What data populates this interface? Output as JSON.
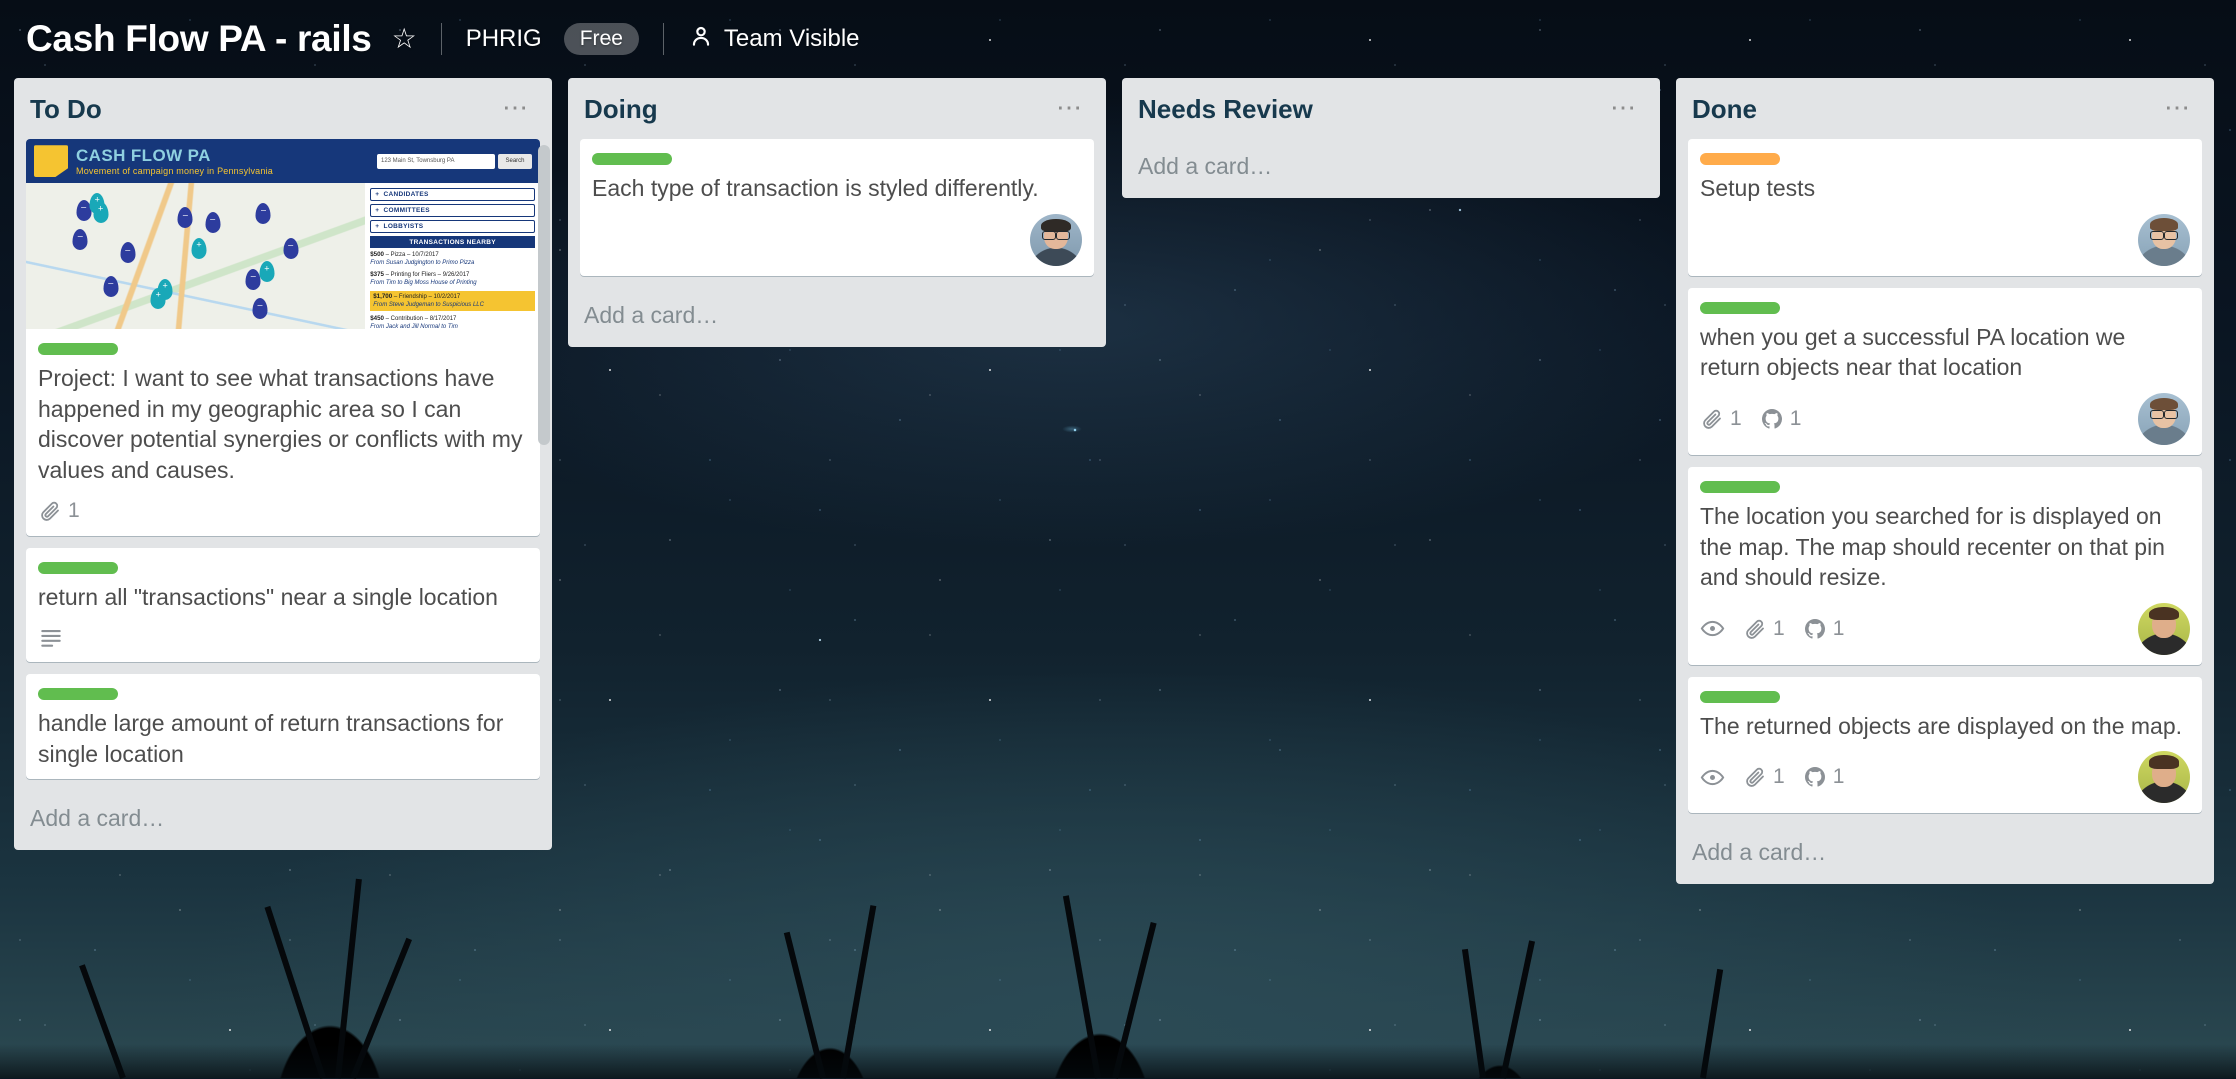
{
  "header": {
    "board_title": "Cash Flow PA - rails",
    "star_icon": "star-icon",
    "team_name": "PHRIG",
    "plan_badge": "Free",
    "visibility_icon": "person-icon",
    "visibility_label": "Team Visible"
  },
  "colors": {
    "label_green": "#61bd4f",
    "label_orange": "#ffab4a",
    "list_bg": "#e2e4e6",
    "card_bg": "#ffffff",
    "title_color": "#17394d",
    "body_text": "#4d4d4d",
    "muted_text": "#838c91"
  },
  "add_card_label": "Add a card…",
  "list_menu_icon": "ellipsis-icon",
  "lists": [
    {
      "title": "To Do",
      "cards": [
        {
          "label_color": "#61bd4f",
          "title": "Project: I want to see what transactions have happened in my geographic area so I can discover potential synergies or conflicts with my values and causes.",
          "cover": true,
          "badges": [
            {
              "icon": "paperclip-icon",
              "count": "1"
            }
          ],
          "avatar": null
        },
        {
          "label_color": "#61bd4f",
          "title": "return all \"transactions\" near a single location",
          "cover": false,
          "badges": [
            {
              "icon": "description-icon",
              "count": ""
            }
          ],
          "avatar": null
        },
        {
          "label_color": "#61bd4f",
          "title": "handle large amount of return transactions for single location",
          "cover": false,
          "badges": [],
          "avatar": null
        }
      ]
    },
    {
      "title": "Doing",
      "cards": [
        {
          "label_color": "#61bd4f",
          "title": "Each type of transaction is styled differently.",
          "cover": false,
          "badges": [],
          "avatar": "f1"
        }
      ]
    },
    {
      "title": "Needs Review",
      "cards": []
    },
    {
      "title": "Done",
      "cards": [
        {
          "label_color": "#ffab4a",
          "title": "Setup tests",
          "cover": false,
          "badges": [],
          "avatar": "f2"
        },
        {
          "label_color": "#61bd4f",
          "title": "when you get a successful PA location we return objects near that location",
          "cover": false,
          "badges": [
            {
              "icon": "paperclip-icon",
              "count": "1"
            },
            {
              "icon": "github-icon",
              "count": "1"
            }
          ],
          "avatar": "f2"
        },
        {
          "label_color": "#61bd4f",
          "title": "The location you searched for is displayed on the map. The map should recenter on that pin and should resize.",
          "cover": false,
          "badges": [
            {
              "icon": "eye-icon",
              "count": ""
            },
            {
              "icon": "paperclip-icon",
              "count": "1"
            },
            {
              "icon": "github-icon",
              "count": "1"
            }
          ],
          "avatar": "f3"
        },
        {
          "label_color": "#61bd4f",
          "title": "The returned objects are displayed on the map.",
          "cover": false,
          "badges": [
            {
              "icon": "eye-icon",
              "count": ""
            },
            {
              "icon": "paperclip-icon",
              "count": "1"
            },
            {
              "icon": "github-icon",
              "count": "1"
            }
          ],
          "avatar": "f3"
        }
      ]
    }
  ],
  "cover_image": {
    "brand": "CASH FLOW PA",
    "tagline": "Movement of campaign money in Pennsylvania",
    "search_value": "123 Main St, Townsburg PA",
    "search_button": "Search",
    "accordions": [
      "CANDIDATES",
      "COMMITTEES",
      "LOBBYISTS"
    ],
    "transactions_header": "TRANSACTIONS NEARBY",
    "transactions": [
      {
        "amount": "$500",
        "desc": "Pizza – 10/7/2017",
        "from": "From Susan Judgington to Primo Pizza",
        "highlight": false
      },
      {
        "amount": "$375",
        "desc": "Printing for Fliers – 9/26/2017",
        "from": "From Tim to Big Moss House of Printing",
        "highlight": false
      },
      {
        "amount": "$1,700",
        "desc": "Friendship – 10/2/2017",
        "from": "From Steve Judgeman to Suspicious LLC",
        "highlight": true
      },
      {
        "amount": "$450",
        "desc": "Contribution – 8/17/2017",
        "from": "From Jack and Jill Normal to Tim",
        "highlight": false
      }
    ]
  }
}
